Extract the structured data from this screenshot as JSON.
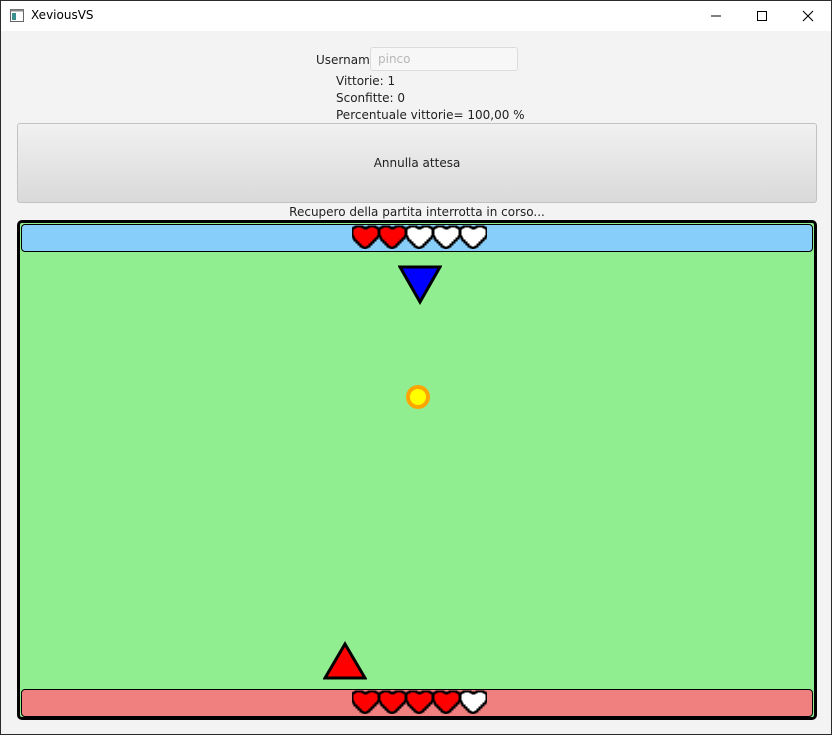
{
  "window": {
    "title": "XeviousVS",
    "controls": [
      "minimize-icon",
      "maximize-icon",
      "close-icon"
    ]
  },
  "profile": {
    "username_label": "Username",
    "username_placeholder": "pinco",
    "username_value": "",
    "wins": "Vittorie: 1",
    "losses": "Sconfitte: 0",
    "win_rate": "Percentuale vittorie= 100,00 %"
  },
  "actions": {
    "cancel_label": "Annulla attesa"
  },
  "status": "Recupero della partita interrotta in corso...",
  "game": {
    "opponent": {
      "lives_total": 5,
      "lives_full": 2,
      "bar_color": "#87cefa",
      "ship_color": "#0000ff",
      "ship_icon": "triangle-down-icon"
    },
    "player": {
      "lives_total": 5,
      "lives_full": 4,
      "bar_color": "#f08080",
      "ship_color": "#ff0000",
      "ship_icon": "triangle-up-icon"
    },
    "field_color": "#90ee90",
    "heart_full_color": "#ff0000",
    "heart_empty_color": "#ffffff",
    "projectile": {
      "fill": "#ffff00",
      "stroke": "#ffa500",
      "icon": "projectile-icon"
    }
  }
}
